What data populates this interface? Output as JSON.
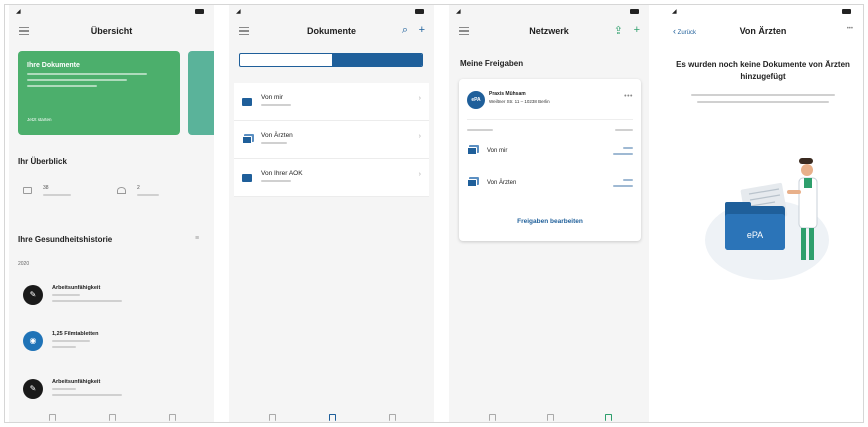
{
  "screen1": {
    "title": "Übersicht",
    "promo": {
      "title": "Ihre Dokumente",
      "link": "Jetzt starten"
    },
    "overview": {
      "title": "Ihr Überblick",
      "documents_count": "38",
      "shares_count": "2"
    },
    "history": {
      "title": "Ihre Gesundheitshistorie",
      "year": "2020",
      "items": [
        {
          "title": "Arbeitsunfähigkeit",
          "icon": "pen-icon"
        },
        {
          "title": "1,25 Filmtabletten",
          "icon": "pill-icon"
        },
        {
          "title": "Arbeitsunfähigkeit",
          "icon": "pen-icon"
        }
      ]
    }
  },
  "screen2": {
    "title": "Dokumente",
    "segments": {
      "left": "",
      "right": ""
    },
    "folders": [
      {
        "name": "Von mir"
      },
      {
        "name": "Von Ärzten"
      },
      {
        "name": "Von Ihrer AOK"
      }
    ]
  },
  "screen3": {
    "title": "Netzwerk",
    "section": "Meine Freigaben",
    "practice": {
      "badge": "ePA",
      "name": "Praxis Mühsam",
      "address": "Weiltner Str. 11 – 10238 Berlin"
    },
    "shares": [
      {
        "label": "Von mir"
      },
      {
        "label": "Von Ärzten"
      }
    ],
    "edit_link": "Freigaben bearbeiten"
  },
  "screen4": {
    "back": "Zurück",
    "title": "Von Ärzten",
    "empty_heading": "Es wurden noch keine Dokumente von Ärzten hinzugefügt",
    "folder_label": "ePA"
  },
  "colors": {
    "primary": "#1f5f9a",
    "promo_green": "#4caf6c",
    "accent_teal": "#2e9f6c",
    "background": "#f5f5f5"
  }
}
